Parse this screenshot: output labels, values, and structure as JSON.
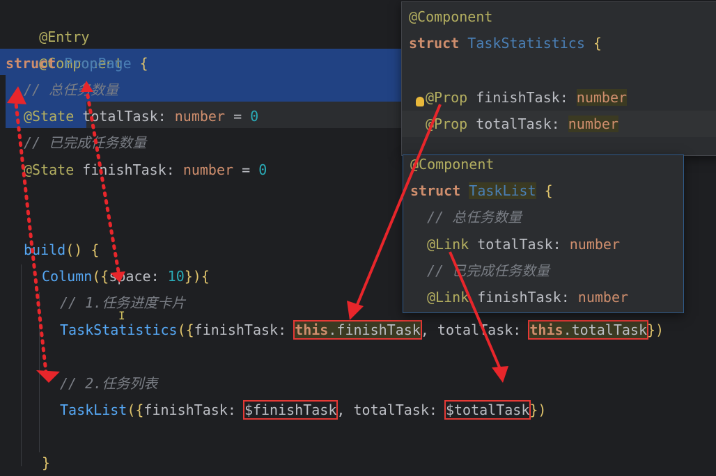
{
  "editor": {
    "lines": {
      "entry": "@Entry",
      "component": "@Component",
      "struct_kw": "struct",
      "struct_name": "PropPage",
      "brace_open": "{",
      "cmt_total": "// 总任务数量",
      "state1_ann": "@State",
      "state1_name": "totalTask",
      "state1_type": "number",
      "state1_eq": "=",
      "state1_val": "0",
      "cmt_finish": "// 已完成任务数量",
      "state2_ann": "@State",
      "state2_name": "finishTask",
      "state2_type": "number",
      "state2_val": "0",
      "build_fn": "build",
      "column_fn": "Column",
      "space_key": "space",
      "space_val": "10",
      "cmt_card": "// 1.任务进度卡片",
      "ts_fn": "TaskStatistics",
      "ts_key1": "finishTask",
      "ts_this1": "this",
      "ts_prop1": "finishTask",
      "ts_key2": "totalTask",
      "ts_this2": "this",
      "ts_prop2": "totalTask",
      "cmt_list": "// 2.任务列表",
      "tl_fn": "TaskList",
      "tl_key1": "finishTask",
      "tl_val1": "$finishTask",
      "tl_key2": "totalTask",
      "tl_val2": "$totalTask",
      "close_brace": "}"
    }
  },
  "popup_stats": {
    "component": "@Component",
    "struct_kw": "struct",
    "struct_name": "TaskStatistics",
    "brace": "{",
    "prop1_ann": "@Prop",
    "prop1_name": "finishTask",
    "prop1_type": "number",
    "prop2_ann": "@Prop",
    "prop2_name": "totalTask",
    "prop2_type": "number"
  },
  "popup_list": {
    "component": "@Component",
    "struct_kw": "struct",
    "struct_name": "TaskList",
    "brace": "{",
    "cmt_total": "// 总任务数量",
    "link1_ann": "@Link",
    "link1_name": "totalTask",
    "link1_type": "number",
    "cmt_finish": "// 已完成任务数量",
    "link2_ann": "@Link",
    "link2_name": "finishTask",
    "link2_type": "number"
  },
  "colors": {
    "background": "#1e1f22",
    "selection": "#214283",
    "annotation_box": "#e53935"
  }
}
